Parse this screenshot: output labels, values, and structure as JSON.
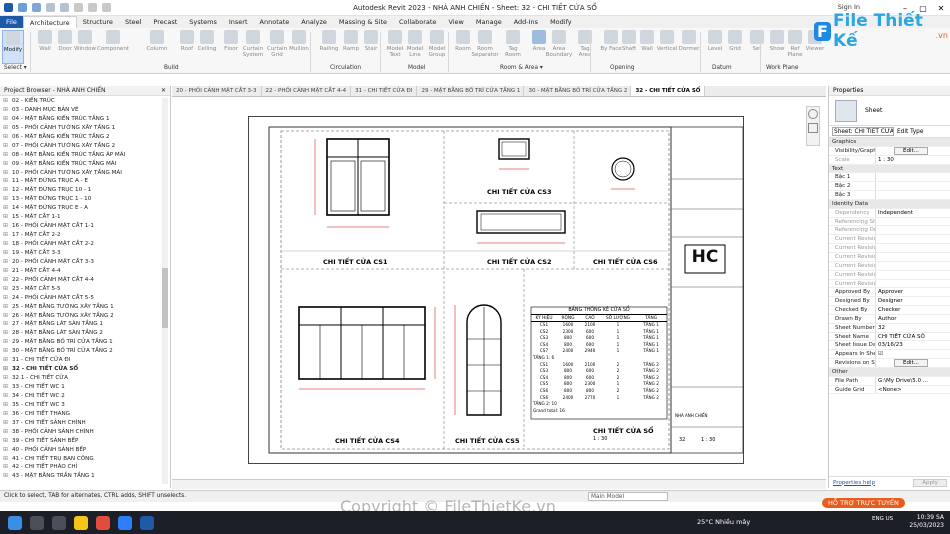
{
  "title_bar": {
    "title": "Autodesk Revit 2023 - NHÀ ANH CHIẾN - Sheet: 32 - CHI TIẾT CỬA SỔ",
    "sign_in": "Sign In"
  },
  "menu_tabs": [
    "File",
    "Architecture",
    "Structure",
    "Steel",
    "Precast",
    "Systems",
    "Insert",
    "Annotate",
    "Analyze",
    "Massing & Site",
    "Collaborate",
    "View",
    "Manage",
    "Add-Ins",
    "Modify"
  ],
  "active_menu_tab": "Architecture",
  "ribbon": {
    "buttons": [
      "Modify",
      "Wall",
      "Door",
      "Window",
      "Component",
      "Column",
      "Roof",
      "Ceiling",
      "Floor",
      "Curtain System",
      "Curtain Grid",
      "Mullion",
      "Railing",
      "Ramp",
      "Stair",
      "Model Text",
      "Model Line",
      "Model Group",
      "Room",
      "Room Separator",
      "Tag Room",
      "Area",
      "Area Boundary",
      "Tag Area",
      "By Face",
      "Shaft",
      "Wall",
      "Vertical",
      "Dormer",
      "Level",
      "Grid",
      "Set",
      "Show",
      "Ref Plane",
      "Viewer"
    ],
    "groups": [
      "Select ▾",
      "Build",
      "Circulation",
      "Model",
      "Room & Area ▾",
      "Opening",
      "Datum",
      "Work Plane"
    ]
  },
  "logo": {
    "text": "File Thiết Kế",
    "domain": ".vn"
  },
  "project_browser": {
    "title": "Project Browser - NHÀ ANH CHIẾN",
    "items": [
      "02 - KIẾN TRÚC",
      "03 - DANH MỤC BẢN VẼ",
      "04 - MẶT BẰNG KIẾN TRÚC TẦNG 1",
      "05 - PHỐI CẢNH TƯỜNG XÂY TẦNG 1",
      "06 - MẶT BẰNG KIẾN TRÚC TẦNG 2",
      "07 - PHỐI CẢNH TƯỜNG XÂY TẦNG 2",
      "08 - MẶT BẰNG KIẾN TRÚC TẦNG ÁP MÁI",
      "09 - MẶT BẰNG KIẾN TRÚC TẦNG MÁI",
      "10 - PHỐI CẢNH TƯỜNG XÂY TẦNG MÁI",
      "11 - MẶT ĐỨNG TRỤC A - E",
      "12 - MẶT ĐỨNG TRỤC 10 - 1",
      "13 - MẶT ĐỨNG TRỤC 1 - 10",
      "14 - MẶT ĐỨNG TRỤC E - A",
      "15 - MẶT CẮT 1-1",
      "16 - PHỐI CẢNH MẶT CẮT 1-1",
      "17 - MẶT CẮT 2-2",
      "18 - PHỐI CẢNH MẶT CẮT 2-2",
      "19 - MẶT CẮT 3-3",
      "20 - PHỐI CẢNH MẶT CẮT 3-3",
      "21 - MẶT CẮT 4-4",
      "22 - PHỐI CẢNH MẶT CẮT 4-4",
      "23 - MẶT CẮT 5-5",
      "24 - PHỐI CẢNH MẶT CẮT 5-5",
      "25 - MẶT BẰNG TƯỜNG XÂY TẦNG 1",
      "26 - MẶT BẰNG TƯỜNG XÂY TẦNG 2",
      "27 - MẶT BẰNG LÁT SÀN TẦNG 1",
      "28 - MẶT BẰNG LÁT SÀN TẦNG 2",
      "29 - MẶT BẰNG BỐ TRÍ CỬA TẦNG 1",
      "30 - MẶT BẰNG BỐ TRÍ CỬA TẦNG 2",
      "31 - CHI TIẾT CỬA ĐI",
      "32 - CHI TIẾT CỬA SỔ",
      "32.1 - CHI TIẾT CỬA",
      "33 - CHI TIẾT WC 1",
      "34 - CHI TIẾT WC 2",
      "35 - CHI TIẾT WC 3",
      "36 - CHI TIẾT THANG",
      "37 - CHI TIẾT SẢNH CHÍNH",
      "38 - PHỐI CẢNH SẢNH CHÍNH",
      "39 - CHI TIẾT SẢNH BẾP",
      "40 - PHỐI CẢNH SẢNH BẾP",
      "41 - CHI TIẾT TRỤ BAN CÔNG",
      "42 - CHI TIẾT PHÀO CHỈ",
      "43 - MẶT BẰNG TRẦN TẦNG 1"
    ],
    "selected": "32 - CHI TIẾT CỬA SỔ"
  },
  "doc_tabs": [
    "20 - PHỐI CẢNH MẶT CẮT 3-3",
    "22 - PHỐI CẢNH MẶT CẮT 4-4",
    "31 - CHI TIẾT CỬA ĐI",
    "29 - MẶT BẰNG BỐ TRÍ CỬA TẦNG 1",
    "30 - MẶT BẰNG BỐ TRÍ CỬA TẦNG 2",
    "32 - CHI TIẾT CỬA SỔ"
  ],
  "active_doc_tab": "32 - CHI TIẾT CỬA SỔ",
  "sheet": {
    "labels": {
      "cs1": "CHI TIẾT CỬA CS1",
      "cs2": "CHI TIẾT CỬA CS2",
      "cs3": "CHI TIẾT CỬA CS3",
      "cs4": "CHI TIẾT CỬA CS4",
      "cs5": "CHI TIẾT CỬA CS5",
      "cs6": "CHI TIẾT CỬA CS6"
    },
    "schedule_title": "BẢNG THỐNG KÊ CỬA SỔ",
    "schedule_headers": [
      "KÝ HIỆU",
      "RỘNG",
      "CAO",
      "SỐ LƯỢNG",
      "TẦNG"
    ],
    "schedule_rows": [
      [
        "CS1",
        "1600",
        "2100",
        "1",
        "TẦNG 1"
      ],
      [
        "CS2",
        "2300",
        "600",
        "1",
        "TẦNG 1"
      ],
      [
        "CS3",
        "800",
        "600",
        "1",
        "TẦNG 1"
      ],
      [
        "CS4",
        "800",
        "600",
        "1",
        "TẦNG 1"
      ],
      [
        "CS7",
        "2400",
        "2940",
        "1",
        "TẦNG 1"
      ],
      [
        "TẦNG 1: 6",
        "",
        "",
        "",
        ""
      ],
      [
        "CS1",
        "1600",
        "2100",
        "2",
        "TẦNG 2"
      ],
      [
        "CS3",
        "800",
        "600",
        "2",
        "TẦNG 2"
      ],
      [
        "CS4",
        "800",
        "600",
        "2",
        "TẦNG 2"
      ],
      [
        "CS5",
        "800",
        "2300",
        "1",
        "TẦNG 2"
      ],
      [
        "CS6",
        "800",
        "800",
        "2",
        "TẦNG 2"
      ],
      [
        "CS6",
        "2400",
        "2770",
        "1",
        "TẦNG 2"
      ],
      [
        "TẦNG 2: 10",
        "",
        "",
        "",
        ""
      ],
      [
        "Grand total: 16",
        "",
        "",
        "",
        ""
      ]
    ],
    "view_title": "CHI TIẾT CỬA SỔ",
    "view_scale": "1 : 30",
    "tb_company": "HC",
    "tb_sheet_no": "32",
    "tb_scale": "1 : 30",
    "tb_project": "NHÀ ANH CHIẾN"
  },
  "properties": {
    "title": "Properties",
    "type": "Sheet",
    "selector": "Sheet: CHI TIẾT CỬA SỔ",
    "edit_type": "Edit Type",
    "rows": [
      {
        "group": "Graphics"
      },
      {
        "k": "Visibility/Graphi...",
        "v": "Edit...",
        "btn": true
      },
      {
        "k": "Scale",
        "v": "1 : 30",
        "gray": true
      },
      {
        "group": "Text"
      },
      {
        "k": "Bậc 1",
        "v": ""
      },
      {
        "k": "Bậc 2",
        "v": ""
      },
      {
        "k": "Bậc 3",
        "v": ""
      },
      {
        "group": "Identity Data"
      },
      {
        "k": "Dependency",
        "v": "Independent",
        "gray": true
      },
      {
        "k": "Referencing Sh...",
        "v": "",
        "gray": true
      },
      {
        "k": "Referencing Det...",
        "v": "",
        "gray": true
      },
      {
        "k": "Current Revisio...",
        "v": "",
        "gray": true
      },
      {
        "k": "Current Revisio...",
        "v": "",
        "gray": true
      },
      {
        "k": "Current Revisio...",
        "v": "",
        "gray": true
      },
      {
        "k": "Current Revisio...",
        "v": "",
        "gray": true
      },
      {
        "k": "Current Revisio...",
        "v": "",
        "gray": true
      },
      {
        "k": "Current Revision",
        "v": "",
        "gray": true
      },
      {
        "k": "Approved By",
        "v": "Approver"
      },
      {
        "k": "Designed By",
        "v": "Designer"
      },
      {
        "k": "Checked By",
        "v": "Checker"
      },
      {
        "k": "Drawn By",
        "v": "Author"
      },
      {
        "k": "Sheet Number",
        "v": "32"
      },
      {
        "k": "Sheet Name",
        "v": "CHI TIẾT CỬA SỔ"
      },
      {
        "k": "Sheet Issue Date",
        "v": "03/16/23"
      },
      {
        "k": "Appears In Shee...",
        "v": "☑"
      },
      {
        "k": "Revisions on Sh...",
        "v": "Edit...",
        "btn": true
      },
      {
        "group": "Other"
      },
      {
        "k": "File Path",
        "v": "G:\\My Drive\\5.0 ..."
      },
      {
        "k": "Guide Grid",
        "v": "<None>"
      }
    ],
    "help": "Properties help",
    "apply": "Apply"
  },
  "status": {
    "text": "Click to select, TAB for alternates, CTRL adds, SHIFT unselects.",
    "model": "Main Model"
  },
  "watermark": "Copyright © FileThietKe.vn",
  "promo": "HỖ TRỢ TRỰC TUYẾN",
  "taskbar": {
    "weather": "25°C  Nhiều mây",
    "lang": "ENG\nUS",
    "time": "10:39 SA",
    "date": "25/03/2023"
  }
}
